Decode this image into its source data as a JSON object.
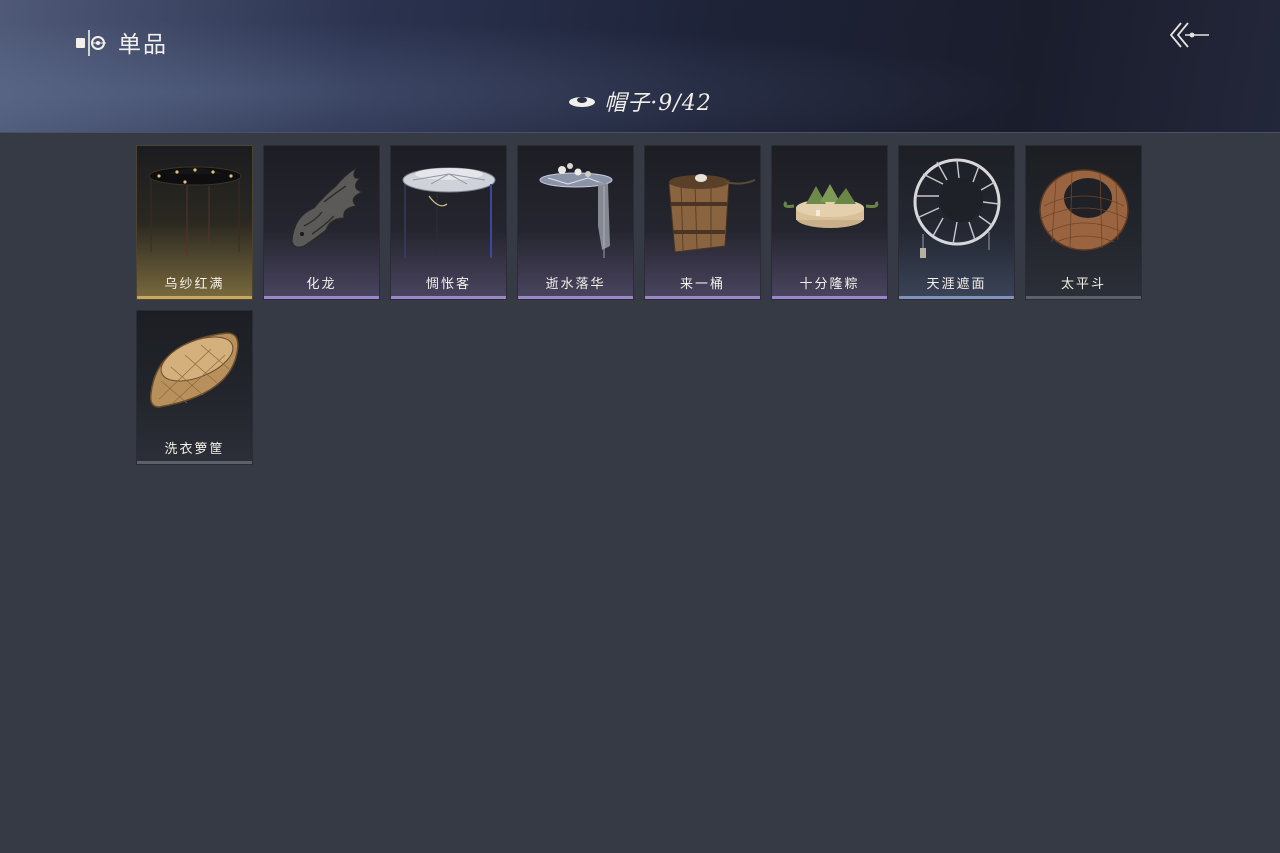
{
  "header": {
    "crumb_label": "单品",
    "title": "帽子·9/42"
  },
  "items": [
    {
      "name": "乌纱红满",
      "rarity": "gold"
    },
    {
      "name": "化龙",
      "rarity": "purple"
    },
    {
      "name": "惆怅客",
      "rarity": "purple"
    },
    {
      "name": "逝水落华",
      "rarity": "purple"
    },
    {
      "name": "来一桶",
      "rarity": "purple"
    },
    {
      "name": "十分隆粽",
      "rarity": "purple"
    },
    {
      "name": "天涯遮面",
      "rarity": "blue"
    },
    {
      "name": "太平斗",
      "rarity": "plain"
    },
    {
      "name": "洗衣箩筐",
      "rarity": "plain"
    }
  ],
  "colors": {
    "background": "#353a44",
    "gold": "#c8a85c",
    "purple": "#9b86c9",
    "blue": "#7f93b8"
  },
  "icons": {
    "crumb": "wardrobe-icon",
    "back": "back-arrow-icon",
    "title": "hat-icon"
  }
}
